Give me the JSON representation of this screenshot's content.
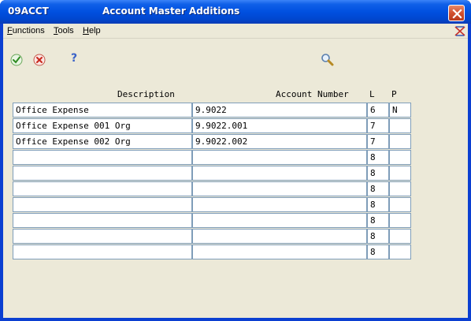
{
  "window": {
    "app_id": "09ACCT",
    "title": "Account Master Additions"
  },
  "menu": {
    "functions_first": "F",
    "functions_rest": "unctions",
    "tools_first": "T",
    "tools_rest": "ools",
    "help_first": "H",
    "help_rest": "elp"
  },
  "toolbar": {
    "ok_icon": "checkmark-icon",
    "cancel_icon": "cancel-icon",
    "help_icon": "question-icon",
    "help_symbol": "?",
    "find_icon": "magnifier-icon"
  },
  "grid": {
    "headers": {
      "description": "Description",
      "account_number": "Account Number",
      "level": "L",
      "posting": "P"
    },
    "rows": [
      {
        "description": "Office Expense",
        "account_number": "9.9022",
        "level": "6",
        "posting": "N"
      },
      {
        "description": "Office Expense 001 Org",
        "account_number": "9.9022.001",
        "level": "7",
        "posting": ""
      },
      {
        "description": "Office Expense 002 Org",
        "account_number": "9.9022.002",
        "level": "7",
        "posting": ""
      },
      {
        "description": "",
        "account_number": "",
        "level": "8",
        "posting": ""
      },
      {
        "description": "",
        "account_number": "",
        "level": "8",
        "posting": ""
      },
      {
        "description": "",
        "account_number": "",
        "level": "8",
        "posting": ""
      },
      {
        "description": "",
        "account_number": "",
        "level": "8",
        "posting": ""
      },
      {
        "description": "",
        "account_number": "",
        "level": "8",
        "posting": ""
      },
      {
        "description": "",
        "account_number": "",
        "level": "8",
        "posting": ""
      },
      {
        "description": "",
        "account_number": "",
        "level": "8",
        "posting": ""
      }
    ]
  }
}
